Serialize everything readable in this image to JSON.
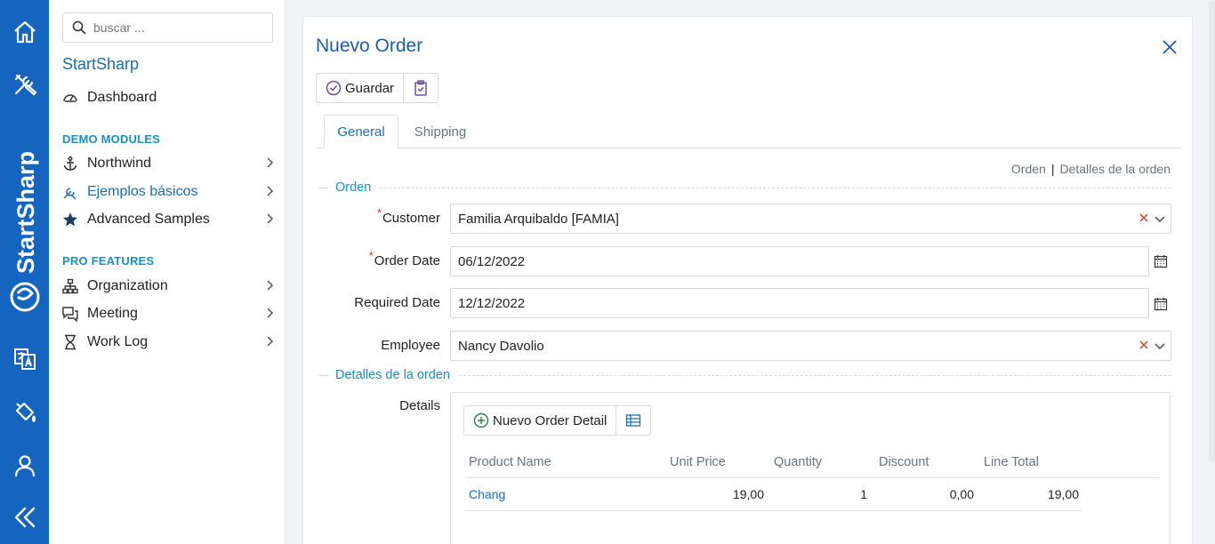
{
  "rail": {
    "brand": "StartSharp",
    "icons": [
      "home-icon",
      "tools-icon",
      "translate-icon",
      "paint-bucket-icon",
      "user-icon",
      "collapse-icon"
    ]
  },
  "sidebar": {
    "search_placeholder": "buscar ...",
    "brand": "StartSharp",
    "dashboard": "Dashboard",
    "section_demo": "DEMO MODULES",
    "northwind": "Northwind",
    "basic_samples": "Ejemplos básicos",
    "advanced_samples": "Advanced Samples",
    "section_pro": "PRO FEATURES",
    "organization": "Organization",
    "meeting": "Meeting",
    "work_log": "Work Log"
  },
  "dialog": {
    "title": "Nuevo Order",
    "save_label": "Guardar",
    "tabs": [
      "General",
      "Shipping"
    ],
    "crumbs": [
      "Orden",
      "Detalles de la orden"
    ],
    "section_order": "Orden",
    "section_details": "Detalles de la orden",
    "fields": {
      "customer_label": "Customer",
      "customer_value": "Familia Arquibaldo [FAMIA]",
      "order_date_label": "Order Date",
      "order_date_value": "06/12/2022",
      "required_date_label": "Required Date",
      "required_date_value": "12/12/2022",
      "employee_label": "Employee",
      "employee_value": "Nancy Davolio",
      "required_mark": "*"
    },
    "details": {
      "label": "Details",
      "add_label": "Nuevo Order Detail",
      "columns": [
        "Product Name",
        "Unit Price",
        "Quantity",
        "Discount",
        "Line Total"
      ],
      "rows": [
        {
          "product": "Chang",
          "unit_price": "19,00",
          "quantity": "1",
          "discount": "0,00",
          "line_total": "19,00"
        }
      ]
    }
  },
  "colors": {
    "rail": "#1565c0",
    "accent": "#1a6fb5",
    "section": "#1a8fc4",
    "required": "#d9372c"
  }
}
